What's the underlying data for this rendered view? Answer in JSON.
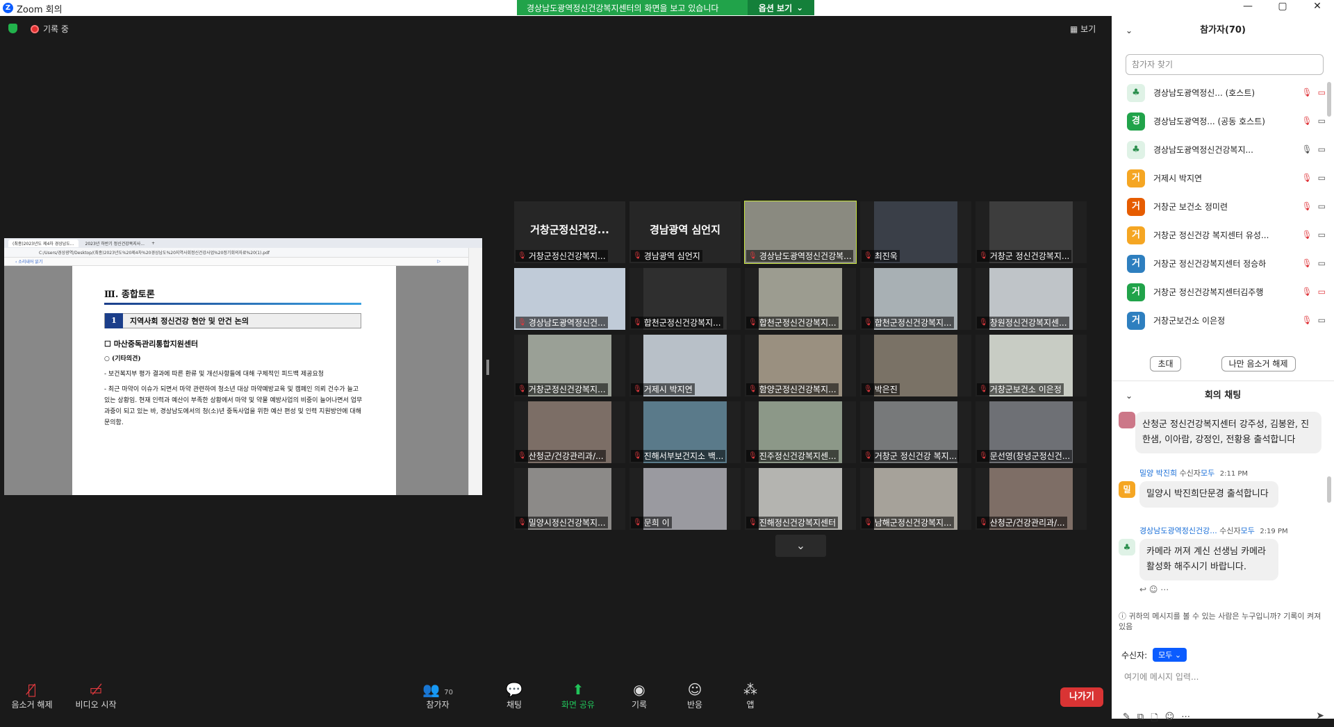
{
  "window": {
    "title": "Zoom 회의",
    "controls": [
      "—",
      "▢",
      "✕"
    ]
  },
  "share_banner": {
    "text": "경상남도광역정신건강복지센터의 화면을 보고 있습니다",
    "options_label": "옵션 보기"
  },
  "status": {
    "recording": "기록 중",
    "view_label": "보기"
  },
  "shared": {
    "tabs": [
      "(최종)2023년도 제4차 경상남도...",
      "2023년 하반기 정신건강복지사...",
      "+"
    ],
    "address": "C:/Users/경상광역/Desktop/(최종)2023년도%20제4차%20경상남도%20지역사회정신건강사업%20정기회의자료%20(1).pdf",
    "pdf_left": "‹ 소리내어 읽기",
    "pdf_right": "▷",
    "section": "Ⅲ. 종합토론",
    "box_num": "1",
    "box_title": "지역사회 정신건강 현안 및 안건 논의",
    "sub": "☐ 마산중독관리통합지원센터",
    "etc": "○ (기타의견)",
    "p1": "- 보건복지부 평가 결과에 따른 환류 및 개선사항들에 대해 구체적인 피드백 제공요청",
    "p2": "- 최근 마약이 이슈가 되면서 마약 관련하여 청소년 대상 마약예방교육 및 캠페인 의뢰 건수가 늘고 있는 상황임. 현재 인력과 예산이 부족한 상황에서 마약 및 약물 예방사업의 비중이 늘어나면서 업무 과중이 되고 있는 바, 경상남도에서의 청(소)년 중독사업을 위한 예산 편성 및 인력 지원방안에 대해 문의함."
  },
  "tiles": [
    {
      "big": "거창군정신건강...",
      "label": "거창군정신건강복지..."
    },
    {
      "big": "경남광역 심언지",
      "label": "경남광역 심언지"
    },
    {
      "label": "경상남도광역정신건강복..."
    },
    {
      "label": "최진욱"
    },
    {
      "label": "거창군 정신건강복지..."
    },
    {
      "label": "경상남도광역정신건..."
    },
    {
      "label": "합천군정신건강복지..."
    },
    {
      "label": "합천군정신건강복지..."
    },
    {
      "label": "합천군정신건강복지..."
    },
    {
      "label": "창원정신건강복지센..."
    },
    {
      "label": "거창군정신건강복지..."
    },
    {
      "label": "거제시 박지연"
    },
    {
      "label": "함양군정신건강복지..."
    },
    {
      "label": "박은진"
    },
    {
      "label": "거창군보건소 이은정"
    },
    {
      "label": "산청군/건강관리과/..."
    },
    {
      "label": "진해서부보건지소 백..."
    },
    {
      "label": "진주정신건강복지센..."
    },
    {
      "label": "거창군 정신건강 복지..."
    },
    {
      "label": "문선영(창녕군정신건..."
    },
    {
      "label": "밀양시정신건강복지..."
    },
    {
      "label": "문희 이"
    },
    {
      "label": "진해정신건강복지센터"
    },
    {
      "label": "남해군정신건강복지..."
    },
    {
      "label": "산청군/건강관리과/..."
    }
  ],
  "tile_colors": [
    "#262626",
    "#262626",
    "#8a8a80",
    "#3a3f48",
    "#3d3d3d",
    "#c0cbd8",
    "#2f2f2f",
    "#9c9c90",
    "#a8b0b4",
    "#bfc4c8",
    "#9aa096",
    "#b8c0c8",
    "#9a9080",
    "#7a7266",
    "#c8ccc4",
    "#7c6e66",
    "#5a7a8a",
    "#8c9888",
    "#77797a",
    "#6e7075",
    "#8c8a88",
    "#9a9aa0",
    "#b4b4b0",
    "#a6a29a",
    "#7e6e66"
  ],
  "toolbar": {
    "mute": "음소거 해제",
    "video": "비디오 시작",
    "participants": "참가자",
    "participants_count": "70",
    "chat": "채팅",
    "share": "화면 공유",
    "record": "기록",
    "reactions": "반응",
    "apps": "앱",
    "leave": "나가기"
  },
  "panel": {
    "title": "참가자(70)",
    "search_placeholder": "참가자 찾기",
    "participants": [
      {
        "avatar": "",
        "name": "경상남도광역정신... (호스트)",
        "color": "tree"
      },
      {
        "avatar": "경",
        "name": "경상남도광역정...  (공동 호스트)",
        "color": "#21a34a"
      },
      {
        "avatar": "",
        "name": "경상남도광역정신건강복지...",
        "color": "tree"
      },
      {
        "avatar": "거",
        "name": "거제시 박지연",
        "color": "#f5a623"
      },
      {
        "avatar": "거",
        "name": "거창군 보건소 정미련",
        "color": "#e65c00"
      },
      {
        "avatar": "거",
        "name": "거창군 정신건강 복지센터 유성...",
        "color": "#f5a623"
      },
      {
        "avatar": "거",
        "name": "거창군 정신건강복지센터 정승하",
        "color": "#2e7fbf"
      },
      {
        "avatar": "거",
        "name": "거창군 정신건강복지센터김주행",
        "color": "#21a34a"
      },
      {
        "avatar": "거",
        "name": "거창군보건소 이은정",
        "color": "#2e7fbf"
      }
    ],
    "invite": "초대",
    "unmute_me": "나만 음소거 해제",
    "chat_title": "회의 채팅",
    "msg1": "산청군 정신건강복지센터 강주성, 김봉완, 진한샘, 이아람, 강정인, 전황용 출석합니다",
    "msg2_sender": "밀양 박진희",
    "msg2_to_label": "수신자",
    "msg2_to": "모두",
    "msg2_time": "2:11 PM",
    "msg2_avatar": "밀",
    "msg2": "밀양시 박진희단문경 출석합니다",
    "msg3_sender": "경상남도광역정신건강...",
    "msg3_to_label": "수신자",
    "msg3_to": "모두",
    "msg3_time": "2:19 PM",
    "msg3": "카메라 꺼져 계신 선생님 카메라 활성화 해주시기 바랍니다.",
    "who_sees": "귀하의 메시지를 볼 수 있는 사람은 누구입니까? 기록이 켜져 있음",
    "recv_label": "수신자:",
    "recv_value": "모두",
    "input_placeholder": "여기에 메시지 입력..."
  }
}
